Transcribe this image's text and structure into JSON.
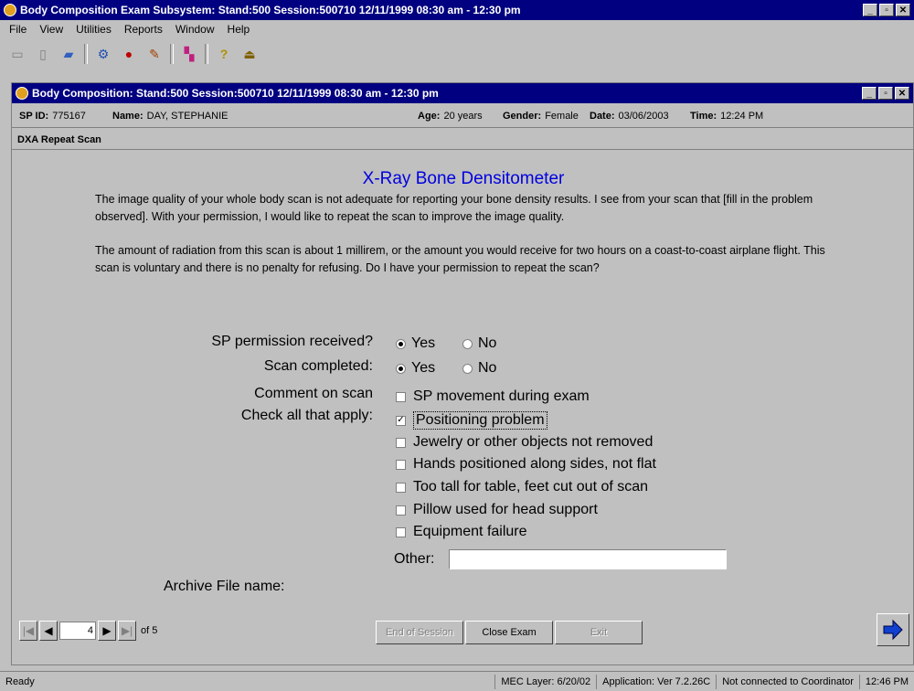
{
  "app": {
    "title": "Body Composition Exam Subsystem: Stand:500 Session:500710 12/11/1999 08:30 am - 12:30 pm",
    "menu": [
      "File",
      "View",
      "Utilities",
      "Reports",
      "Window",
      "Help"
    ],
    "window_buttons": [
      "_",
      "▫",
      "✕"
    ]
  },
  "toolbar": {
    "icons": [
      "open-icon",
      "document-icon",
      "folder-icon",
      "network-icon",
      "record-icon",
      "edit-icon",
      "chart-icon",
      "help-icon",
      "exit-icon"
    ],
    "glyphs": [
      "▭",
      "▯",
      "▰",
      "⚙",
      "●",
      "✎",
      "▚",
      "?",
      "⏏"
    ]
  },
  "child": {
    "title": "Body Composition: Stand:500 Session:500710 12/11/1999 08:30 am - 12:30 pm",
    "sp_id_label": "SP ID:",
    "sp_id": "775167",
    "name_label": "Name:",
    "name": "DAY, STEPHANIE",
    "age_label": "Age:",
    "age": "20 years",
    "gender_label": "Gender:",
    "gender": "Female",
    "date_label": "Date:",
    "date": "03/06/2003",
    "time_label": "Time:",
    "time": "12:24 PM",
    "section": "DXA Repeat Scan"
  },
  "form": {
    "heading": "X-Ray Bone Densitometer",
    "paragraph1": "The image quality of your whole body scan is not adequate for reporting your bone density results. I see from your scan that [fill in the problem observed]. With your permission, I would like to repeat the scan to improve the image quality.",
    "paragraph2": "The amount of radiation from this scan is about 1 millirem, or the amount you would receive for two hours on a coast-to-coast airplane flight. This scan is voluntary and there is no penalty for refusing. Do I have your permission to repeat the scan?",
    "q1_label": "SP permission received?",
    "q2_label": "Scan completed:",
    "yes": "Yes",
    "no": "No",
    "q1_value": "Yes",
    "q2_value": "Yes",
    "comment_label": "Comment on scan",
    "check_label": "Check all that apply:",
    "checks": [
      {
        "label": "SP movement during exam",
        "checked": false
      },
      {
        "label": "Positioning problem",
        "checked": true
      },
      {
        "label": "Jewelry or other objects not removed",
        "checked": false
      },
      {
        "label": "Hands positioned along sides, not flat",
        "checked": false
      },
      {
        "label": "Too tall for table, feet cut out of scan",
        "checked": false
      },
      {
        "label": "Pillow used for head support",
        "checked": false
      },
      {
        "label": "Equipment failure",
        "checked": false
      }
    ],
    "other_label": "Other:",
    "other_value": "",
    "archive_label": "Archive File name:"
  },
  "nav": {
    "page": "4",
    "of_label": "of 5",
    "end_session": "End of Session",
    "close_exam": "Close Exam",
    "exit": "Exit"
  },
  "status": {
    "ready": "Ready",
    "mec_layer": "MEC Layer: 6/20/02",
    "application": "Application: Ver 7.2.26C",
    "coordinator": "Not connected to Coordinator",
    "clock": "12:46 PM"
  }
}
